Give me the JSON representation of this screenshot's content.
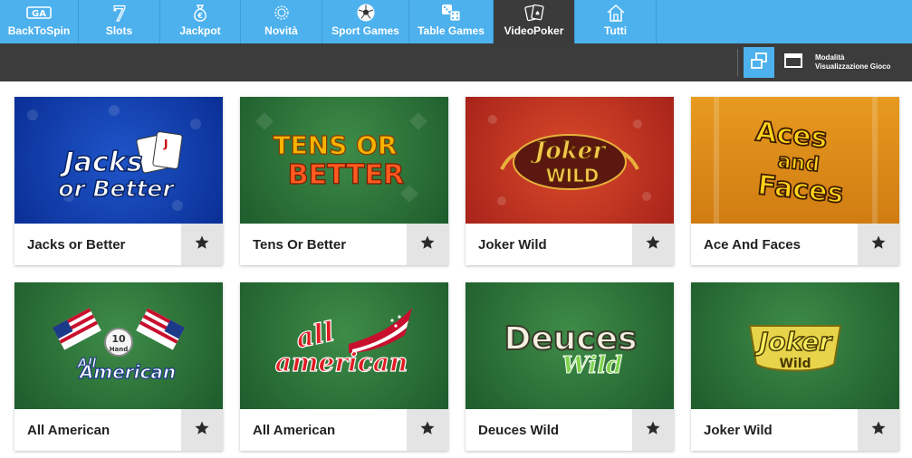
{
  "nav": {
    "items": [
      {
        "label": "BackToSpin",
        "icon": "backtospin-logo-icon",
        "active": false
      },
      {
        "label": "Slots",
        "icon": "seven-icon",
        "active": false
      },
      {
        "label": "Jackpot",
        "icon": "money-bag-icon",
        "active": false
      },
      {
        "label": "Novità",
        "icon": "badge-icon",
        "active": false
      },
      {
        "label": "Sport Games",
        "icon": "soccer-ball-icon",
        "active": false
      },
      {
        "label": "Table Games",
        "icon": "dice-icon",
        "active": false
      },
      {
        "label": "VideoPoker",
        "icon": "cards-icon",
        "active": true
      },
      {
        "label": "Tutti",
        "icon": "home-icon",
        "active": false
      }
    ]
  },
  "toolbar": {
    "view_mode_line1": "Modalità",
    "view_mode_line2": "Visualizzazione Gioco",
    "grid_icon": "grid-view-icon",
    "list_icon": "list-view-icon"
  },
  "games": [
    {
      "title": "Jacks or Better",
      "logo": [
        "Jacks",
        "or Better"
      ]
    },
    {
      "title": "Tens Or Better",
      "logo": [
        "TENS OR",
        "BETTER"
      ]
    },
    {
      "title": "Joker Wild",
      "logo": [
        "Joker",
        "WILD"
      ]
    },
    {
      "title": "Ace And Faces",
      "logo": [
        "Aces",
        "and",
        "Faces"
      ]
    },
    {
      "title": "All American",
      "logo": [
        "10",
        "Hand",
        "All",
        "American"
      ]
    },
    {
      "title": "All American",
      "logo": [
        "all",
        "american"
      ]
    },
    {
      "title": "Deuces Wild",
      "logo": [
        "Deuces",
        "Wild"
      ]
    },
    {
      "title": "Joker Wild",
      "logo": [
        "Joker",
        "Wild"
      ]
    }
  ],
  "colors": {
    "nav_bg": "#4db1ee",
    "active_bg": "#3b3b3b",
    "toolbar_bg": "#3c3c3c",
    "fav_bg": "#e4e4e4"
  }
}
